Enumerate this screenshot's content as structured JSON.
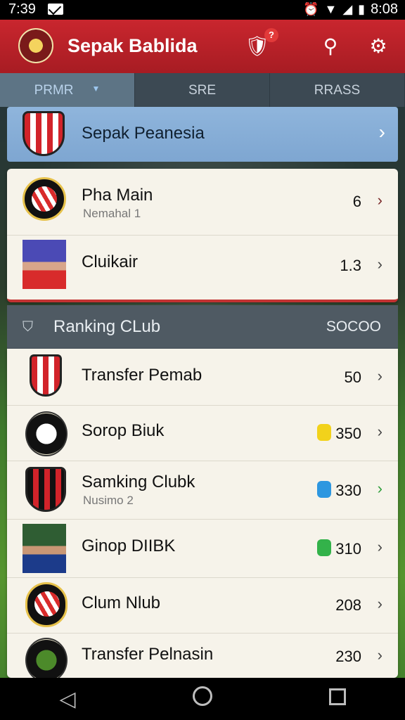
{
  "status_bar": {
    "time": "7:39",
    "clock": "8:08"
  },
  "app_bar": {
    "title": "Sepak Bablida",
    "notification_count": "?",
    "colors": {
      "primary": "#c9262e",
      "accent_banner": "#8fb5dc"
    }
  },
  "tabs": [
    {
      "label": "PRMR",
      "active": true
    },
    {
      "label": "SRE",
      "active": false
    },
    {
      "label": "RRASS",
      "active": false
    }
  ],
  "banner": {
    "label": "Sepak Peanesia"
  },
  "top_list": [
    {
      "name": "Pha Main",
      "sub": "Nemahal 1",
      "value": "6"
    },
    {
      "name": "Cluikair",
      "sub": "",
      "value": "1.3"
    }
  ],
  "section": {
    "title": "Ranking CLub",
    "value": "SOCOO"
  },
  "ranking_list": [
    {
      "name": "Transfer Pemab",
      "sub": "",
      "value": "50",
      "coin_color": ""
    },
    {
      "name": "Sorop Biuk",
      "sub": "",
      "value": "350",
      "coin_color": "#f2d21b"
    },
    {
      "name": "Samking Clubk",
      "sub": "Nusimo 2",
      "value": "330",
      "coin_color": "#2d97e0"
    },
    {
      "name": "Ginop DIIBK",
      "sub": "",
      "value": "310",
      "coin_color": "#33b24a"
    },
    {
      "name": "Clum Nlub",
      "sub": "",
      "value": "208",
      "coin_color": ""
    },
    {
      "name": "Transfer Pelnasin",
      "sub": "",
      "value": "230",
      "coin_color": ""
    }
  ]
}
